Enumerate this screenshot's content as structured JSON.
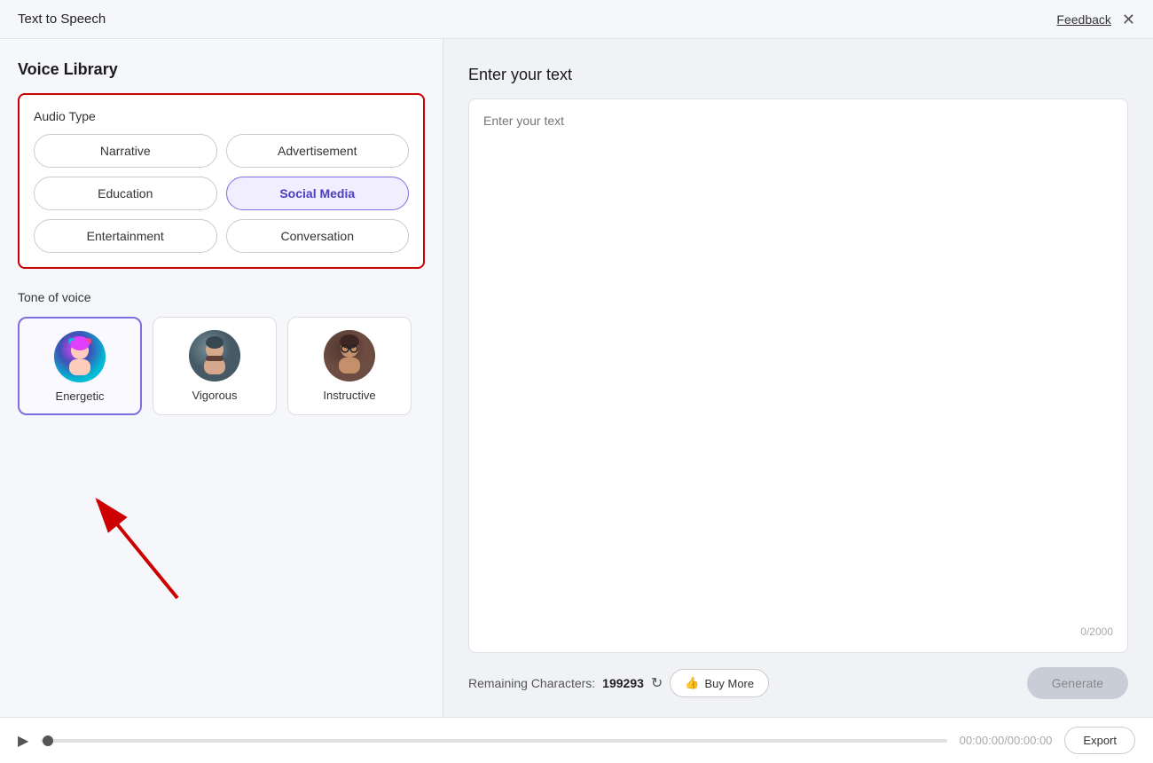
{
  "header": {
    "title": "Text to Speech",
    "feedback_label": "Feedback",
    "close_icon": "✕"
  },
  "left_panel": {
    "title": "Voice Library",
    "audio_type": {
      "label": "Audio Type",
      "options": [
        {
          "id": "narrative",
          "label": "Narrative",
          "selected": false
        },
        {
          "id": "advertisement",
          "label": "Advertisement",
          "selected": false
        },
        {
          "id": "education",
          "label": "Education",
          "selected": false
        },
        {
          "id": "social_media",
          "label": "Social Media",
          "selected": true
        },
        {
          "id": "entertainment",
          "label": "Entertainment",
          "selected": false
        },
        {
          "id": "conversation",
          "label": "Conversation",
          "selected": false
        }
      ]
    },
    "tone_of_voice": {
      "label": "Tone of voice",
      "options": [
        {
          "id": "energetic",
          "label": "Energetic",
          "selected": true
        },
        {
          "id": "vigorous",
          "label": "Vigorous",
          "selected": false
        },
        {
          "id": "instructive",
          "label": "Instructive",
          "selected": false
        }
      ]
    }
  },
  "right_panel": {
    "title": "Enter your text",
    "textarea_placeholder": "Enter your text",
    "char_count": "0/2000",
    "remaining_label": "Remaining Characters:",
    "remaining_count": "199293",
    "buy_more_label": "Buy More",
    "generate_label": "Generate"
  },
  "player": {
    "time_display": "00:00:00/00:00:00",
    "export_label": "Export"
  }
}
